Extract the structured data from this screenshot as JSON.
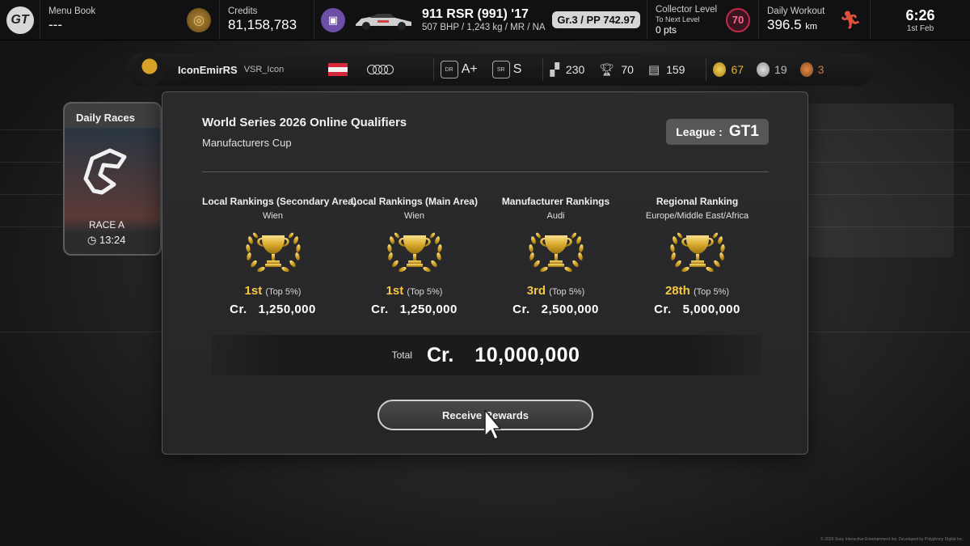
{
  "topbar": {
    "logo": "GT",
    "menu_book": {
      "label": "Menu Book",
      "value": "---",
      "icon": "menu-book-icon"
    },
    "credits": {
      "label": "Credits",
      "value": "81,158,783"
    },
    "car": {
      "icon": "garage-icon",
      "name": "911 RSR (991) '17",
      "spec": "507 BHP / 1,243 kg / MR / NA",
      "badge": "Gr.3 / PP 742.97"
    },
    "collector": {
      "label": "Collector Level",
      "sub": "To Next Level",
      "pts": "0 pts",
      "level": "70"
    },
    "workout": {
      "label": "Daily Workout",
      "value": "396.5",
      "unit": "km",
      "icon": "runner-icon"
    },
    "clock": {
      "time": "6:26",
      "date": "1st Feb"
    }
  },
  "profile": {
    "name": "IconEmirRS",
    "tag": "VSR_Icon",
    "flag_colors": [
      "#d8283a",
      "#f2f2f2",
      "#d8283a"
    ],
    "manufacturer": "audi-rings-icon",
    "dr": "A+",
    "sr": "S",
    "checkered": "230",
    "trophies": "70",
    "top5": "159",
    "gold": "67",
    "silver": "19",
    "bronze": "3"
  },
  "sidecard": {
    "title": "Daily Races",
    "race": "RACE A",
    "time": "13:24"
  },
  "dialog": {
    "title": "World Series 2026 Online Qualifiers",
    "subtitle": "Manufacturers Cup",
    "league_label": "League :",
    "league_value": "GT1",
    "rankings": [
      {
        "name": "Local Rankings (Secondary Area)",
        "area": "Wien",
        "pos": "1st",
        "top": "(Top 5%)",
        "cr": "Cr.",
        "amount": "1,250,000"
      },
      {
        "name": "Local Rankings (Main Area)",
        "area": "Wien",
        "pos": "1st",
        "top": "(Top 5%)",
        "cr": "Cr.",
        "amount": "1,250,000"
      },
      {
        "name": "Manufacturer Rankings",
        "area": "Audi",
        "pos": "3rd",
        "top": "(Top 5%)",
        "cr": "Cr.",
        "amount": "2,500,000"
      },
      {
        "name": "Regional Ranking",
        "area": "Europe/Middle East/Africa",
        "pos": "28th",
        "top": "(Top 5%)",
        "cr": "Cr.",
        "amount": "5,000,000"
      }
    ],
    "total_label": "Total",
    "total_cr": "Cr.",
    "total_value": "10,000,000",
    "button": "Receive Rewards"
  },
  "copyright": "© 2026 Sony Interactive Entertainment Inc. Developed by Polyphony Digital Inc.",
  "colors": {
    "gold": "#f5c842",
    "accent_red": "#c22a48"
  }
}
